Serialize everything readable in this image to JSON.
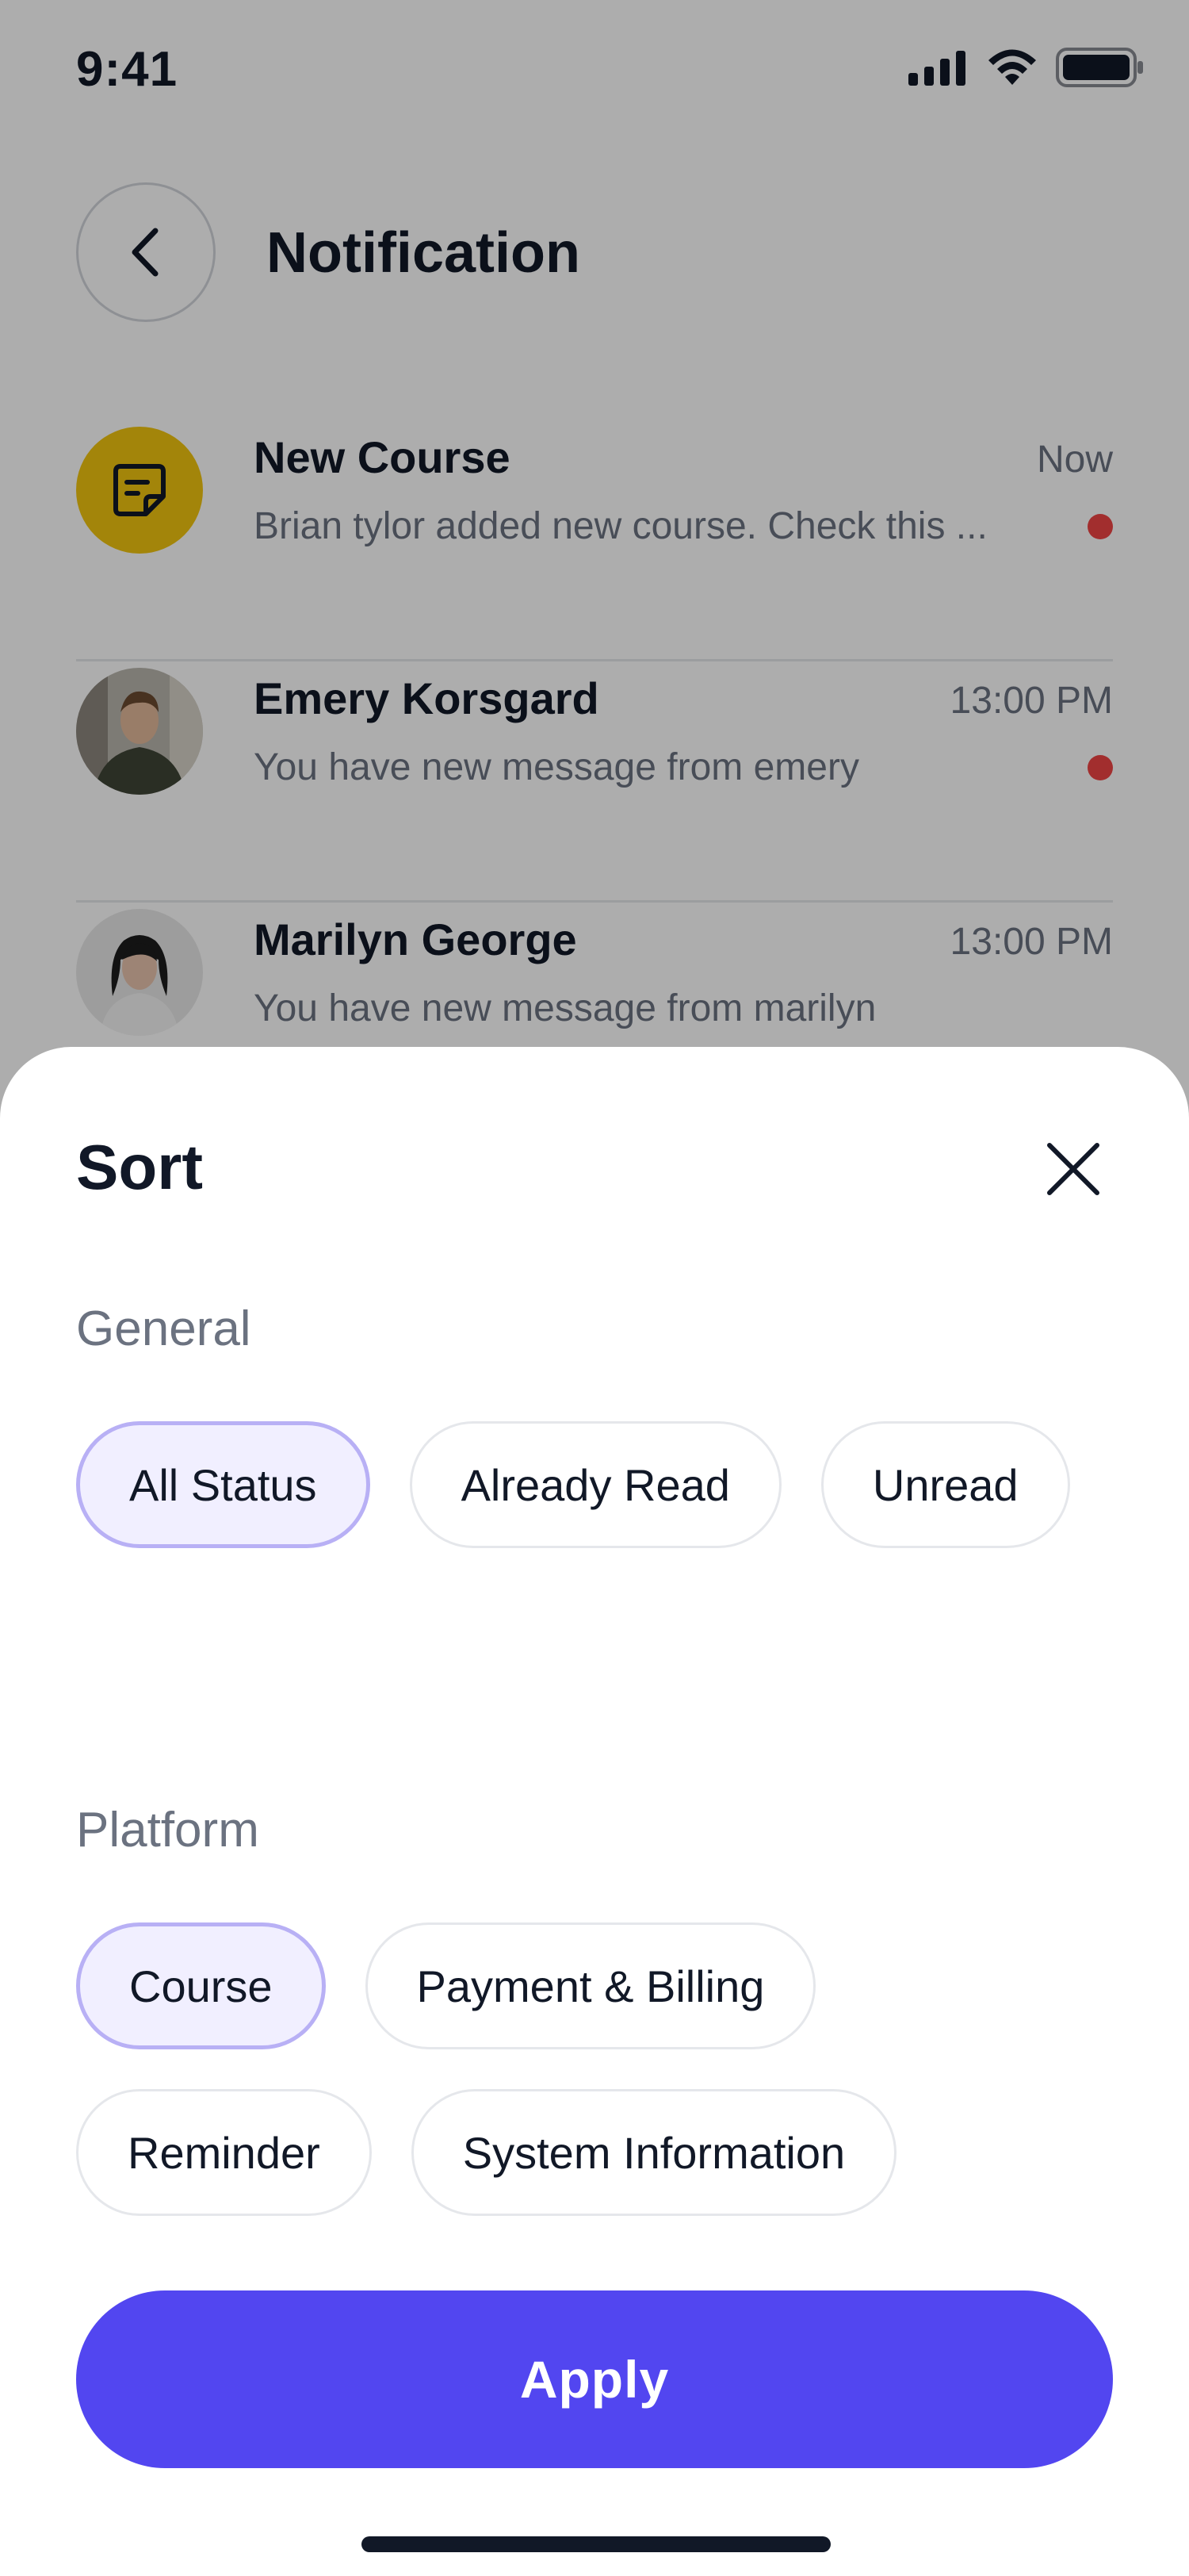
{
  "status_bar": {
    "time": "9:41"
  },
  "header": {
    "title": "Notification"
  },
  "notifications": [
    {
      "title": "New Course",
      "time": "Now",
      "message": "Brian tylor added new course. Check this ...",
      "unread": true,
      "avatar": "course-icon"
    },
    {
      "title": "Emery Korsgard",
      "time": "13:00 PM",
      "message": "You have new message from emery",
      "unread": true,
      "avatar": "user-photo"
    },
    {
      "title": "Marilyn George",
      "time": "13:00 PM",
      "message": "You have new message from marilyn",
      "unread": false,
      "avatar": "user-photo"
    }
  ],
  "sheet": {
    "title": "Sort",
    "general": {
      "label": "General",
      "options": [
        "All Status",
        "Already Read",
        "Unread"
      ],
      "selected": "All Status"
    },
    "platform": {
      "label": "Platform",
      "options": [
        "Course",
        "Payment & Billing",
        "Reminder",
        "System Information"
      ],
      "selected": "Course"
    },
    "apply_label": "Apply"
  },
  "colors": {
    "accent": "#5246f0",
    "chip_active_bg": "#f1efff",
    "chip_active_border": "#b8b0f5",
    "unread_dot": "#ef4444",
    "course_badge": "#f1c40f"
  }
}
